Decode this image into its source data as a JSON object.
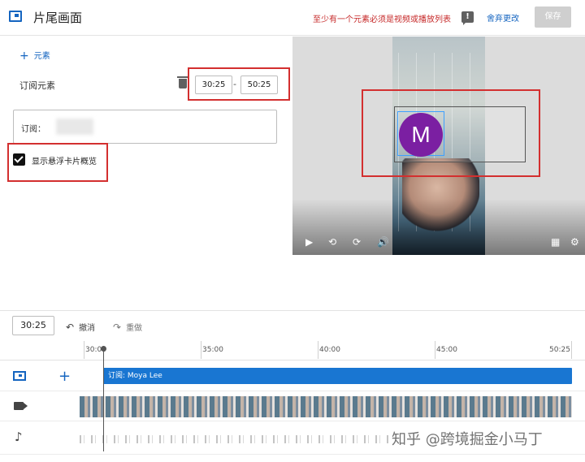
{
  "header": {
    "title": "片尾画面",
    "warning": "至少有一个元素必须是视频或播放列表",
    "feedback_icon": "!",
    "discard": "舍弃更改",
    "save": "保存"
  },
  "editor": {
    "add_element": "元素",
    "add_icon": "+",
    "element_label": "订阅元素",
    "start_time": "30:25",
    "end_time": "50:25",
    "dash": "-",
    "subscribe_field_label": "订阅：",
    "show_hover_card": "显示悬浮卡片概览",
    "show_hover_card_checked": true
  },
  "preview": {
    "avatar_letter": "M",
    "controls": [
      "▶",
      "⟲",
      "⟳",
      "🔊",
      "▦",
      "⚙"
    ]
  },
  "timeline": {
    "current_time": "30:25",
    "undo": "撤消",
    "redo": "重做",
    "undo_icon": "↶",
    "redo_icon": "↷",
    "ticks": [
      "30:00",
      "35:00",
      "40:00",
      "45:00",
      "50:25"
    ],
    "row_add": "+",
    "subscribe_bar": "订阅: Moya Lee",
    "music_icon": "♪"
  },
  "watermark": "知乎 @跨境掘金小马丁",
  "colors": {
    "accent": "#1565c0",
    "warning": "#c62828",
    "highlight_box": "#d32f2f",
    "avatar": "#7b1fa2",
    "bar": "#1976d2"
  }
}
